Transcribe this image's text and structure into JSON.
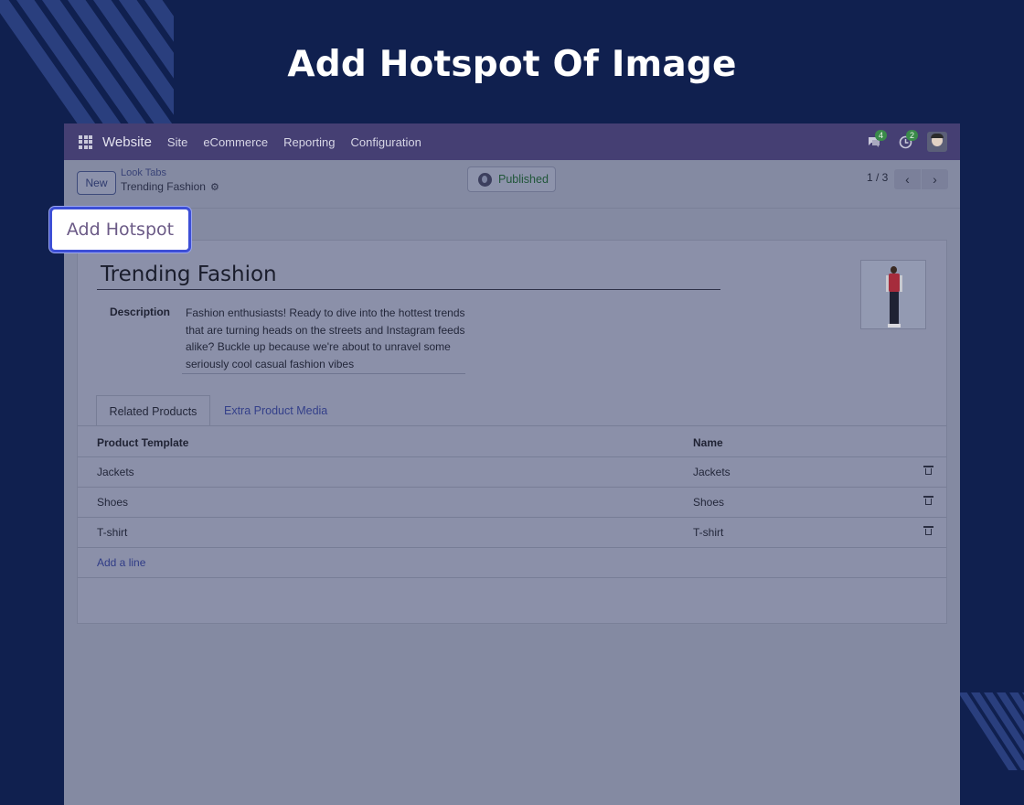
{
  "page": {
    "title": "Add Hotspot Of Image"
  },
  "callout": {
    "label": "Add Hotspot"
  },
  "navbar": {
    "brand": "Website",
    "items": [
      {
        "label": "Site"
      },
      {
        "label": "eCommerce"
      },
      {
        "label": "Reporting"
      },
      {
        "label": "Configuration"
      }
    ],
    "messages_count": "4",
    "activities_count": "2"
  },
  "control_panel": {
    "new_label": "New",
    "breadcrumb_parent": "Look Tabs",
    "breadcrumb_current": "Trending Fashion",
    "status_label": "Published",
    "pager": "1 / 3"
  },
  "record": {
    "title": "Trending Fashion",
    "description_label": "Description",
    "description": "Fashion enthusiasts!  Ready to dive into the hottest trends that are turning heads on the streets and Instagram feeds alike? Buckle up because we're about to unravel some seriously cool casual fashion vibes"
  },
  "tabs": [
    {
      "label": "Related Products"
    },
    {
      "label": "Extra Product Media"
    }
  ],
  "table": {
    "headers": [
      "Product Template",
      "Name"
    ],
    "rows": [
      {
        "template": "Jackets",
        "name": "Jackets"
      },
      {
        "template": "Shoes",
        "name": "Shoes"
      },
      {
        "template": "T-shirt",
        "name": "T-shirt"
      }
    ],
    "add_line": "Add a line"
  },
  "colors": {
    "background": "#10204f",
    "navbar": "#453f73",
    "callout_border": "#3d4fd6"
  }
}
